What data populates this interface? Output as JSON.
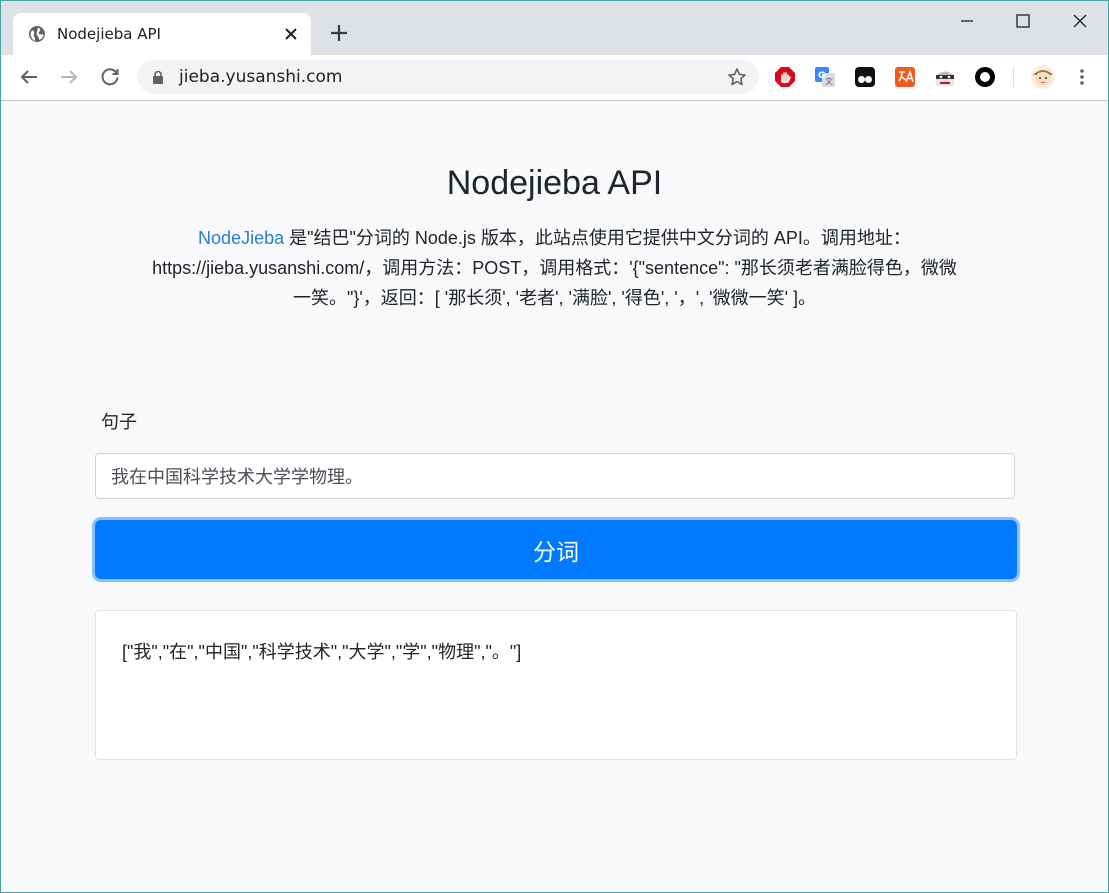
{
  "browser": {
    "tab_title": "Nodejieba API",
    "url": "jieba.yusanshi.com"
  },
  "page": {
    "title": "Nodejieba API",
    "intro_link": "NodeJieba",
    "intro_line1_rest": " 是\"结巴\"分词的 Node.js 版本，此站点使用它提供中文分词的 API。调用地址：",
    "intro_line2": "https://jieba.yusanshi.com/，调用方法：POST，调用格式：'{\"sentence\": \"那长须老者满脸得色，微微",
    "intro_line3": "一笑。\"}'，返回：[ '那长须', '老者', '满脸', '得色', '，', '微微一笑' ]。",
    "field_label": "句子",
    "input_value": "我在中国科学技术大学学物理。",
    "button_label": "分词",
    "result": "[\"我\",\"在\",\"中国\",\"科学技术\",\"大学\",\"学\",\"物理\",\"。\"]"
  },
  "colors": {
    "primary": "#007bff",
    "link": "#2b7bd8"
  },
  "icons": {
    "favicon": "globe-icon",
    "extensions": [
      "adblock-icon",
      "google-translate-icon",
      "tampermonkey-icon",
      "translate-tool-icon",
      "incognito-mask-icon",
      "circle-extension-icon",
      "profile-avatar-icon"
    ]
  }
}
